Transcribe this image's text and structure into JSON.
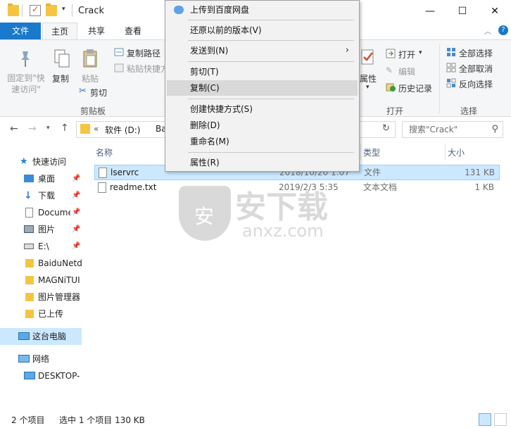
{
  "window": {
    "title": "Crack",
    "minimize": "—",
    "maximize": "☐",
    "close": "✕"
  },
  "tabs": [
    "文件",
    "主页",
    "共享",
    "查看"
  ],
  "ribbon": {
    "clipboard": {
      "pin_label": "固定到\"快\n速访问\"",
      "copy": "复制",
      "paste": "粘贴",
      "copy_path": "复制路径",
      "paste_shortcut": "粘贴快捷方",
      "cut": "剪切",
      "group": "剪贴板"
    },
    "open": {
      "properties": "属性",
      "open": "打开",
      "edit": "编辑",
      "history": "历史记录",
      "group": "打开"
    },
    "select": {
      "select_all": "全部选择",
      "select_none": "全部取消",
      "invert": "反向选择",
      "group": "选择"
    }
  },
  "address": {
    "crumb_prefix": "«",
    "drive": "软件 (D:)",
    "crumb_more": "Ba",
    "search_placeholder": "搜索\"Crack\""
  },
  "nav": {
    "quick_access": "快速访问",
    "items": [
      {
        "label": "桌面",
        "pinned": true
      },
      {
        "label": "下载",
        "pinned": true
      },
      {
        "label": "Docume",
        "pinned": true
      },
      {
        "label": "图片",
        "pinned": true
      },
      {
        "label": "E:\\",
        "pinned": true
      },
      {
        "label": "BaiduNetd",
        "pinned": false
      },
      {
        "label": "MAGNiTUI",
        "pinned": false
      },
      {
        "label": "图片管理器",
        "pinned": false
      },
      {
        "label": "已上传",
        "pinned": false
      }
    ],
    "this_pc": "这台电脑",
    "network": "网络",
    "desktop": "DESKTOP-"
  },
  "columns": {
    "name": "名称",
    "type": "类型",
    "size": "大小"
  },
  "files": [
    {
      "name": "lservrc",
      "date": "2018/10/20 1:07",
      "type": "文件",
      "size": "131 KB",
      "selected": true
    },
    {
      "name": "readme.txt",
      "date": "2019/2/3 5:35",
      "type": "文本文档",
      "size": "1 KB",
      "selected": false
    }
  ],
  "watermark": {
    "text": "安下载",
    "sub": "anxz.com",
    "badge": "安"
  },
  "status": {
    "count": "2 个项目",
    "selection": "选中 1 个项目  130 KB"
  },
  "context_menu": {
    "items": [
      {
        "label": "上传到百度网盘"
      },
      {
        "label": "还原以前的版本(V)"
      },
      {
        "label": "发送到(N)",
        "submenu": "›"
      },
      {
        "label": "剪切(T)"
      },
      {
        "label": "复制(C)"
      },
      {
        "label": "创建快捷方式(S)"
      },
      {
        "label": "删除(D)"
      },
      {
        "label": "重命名(M)"
      },
      {
        "label": "属性(R)"
      }
    ]
  },
  "colors": {
    "accent": "#1979ca",
    "selection": "#cce8ff",
    "ribbon_bg": "#f5f6f7",
    "folder": "#f5c542"
  }
}
